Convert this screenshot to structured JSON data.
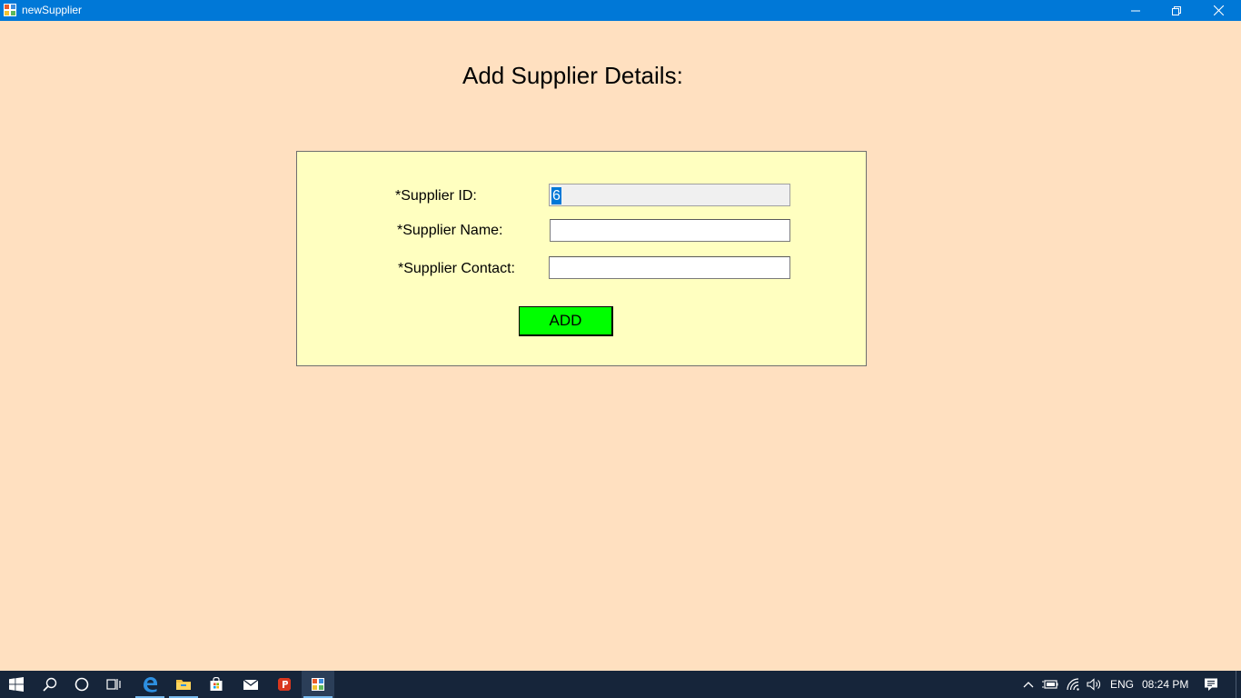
{
  "window": {
    "title": "newSupplier",
    "controls": [
      "minimize-icon",
      "restore-icon",
      "close-icon"
    ]
  },
  "form": {
    "heading": "Add Supplier Details:",
    "fields": [
      {
        "label": "*Supplier ID:",
        "value": "6",
        "placeholder": "",
        "readonly": true
      },
      {
        "label": "*Supplier Name:",
        "value": "",
        "placeholder": "",
        "readonly": false
      },
      {
        "label": "*Supplier Contact:",
        "value": "",
        "placeholder": "",
        "readonly": false
      }
    ],
    "add_button": "ADD"
  },
  "taskbar": {
    "apps": [
      "start-icon",
      "search-icon",
      "cortana-icon",
      "task-view-icon",
      "edge-icon",
      "file-explorer-icon",
      "store-icon",
      "mail-icon",
      "psiphon-icon",
      "newsupplier-app-icon"
    ],
    "tray": {
      "language": "ENG",
      "time": "08:24 PM"
    }
  },
  "colors": {
    "titlebar": "#0078D7",
    "background": "#FFE0C0",
    "panel": "#FFFFC0",
    "add_button": "#00FF00",
    "taskbar": "#16253A",
    "selection": "#0078D7"
  }
}
